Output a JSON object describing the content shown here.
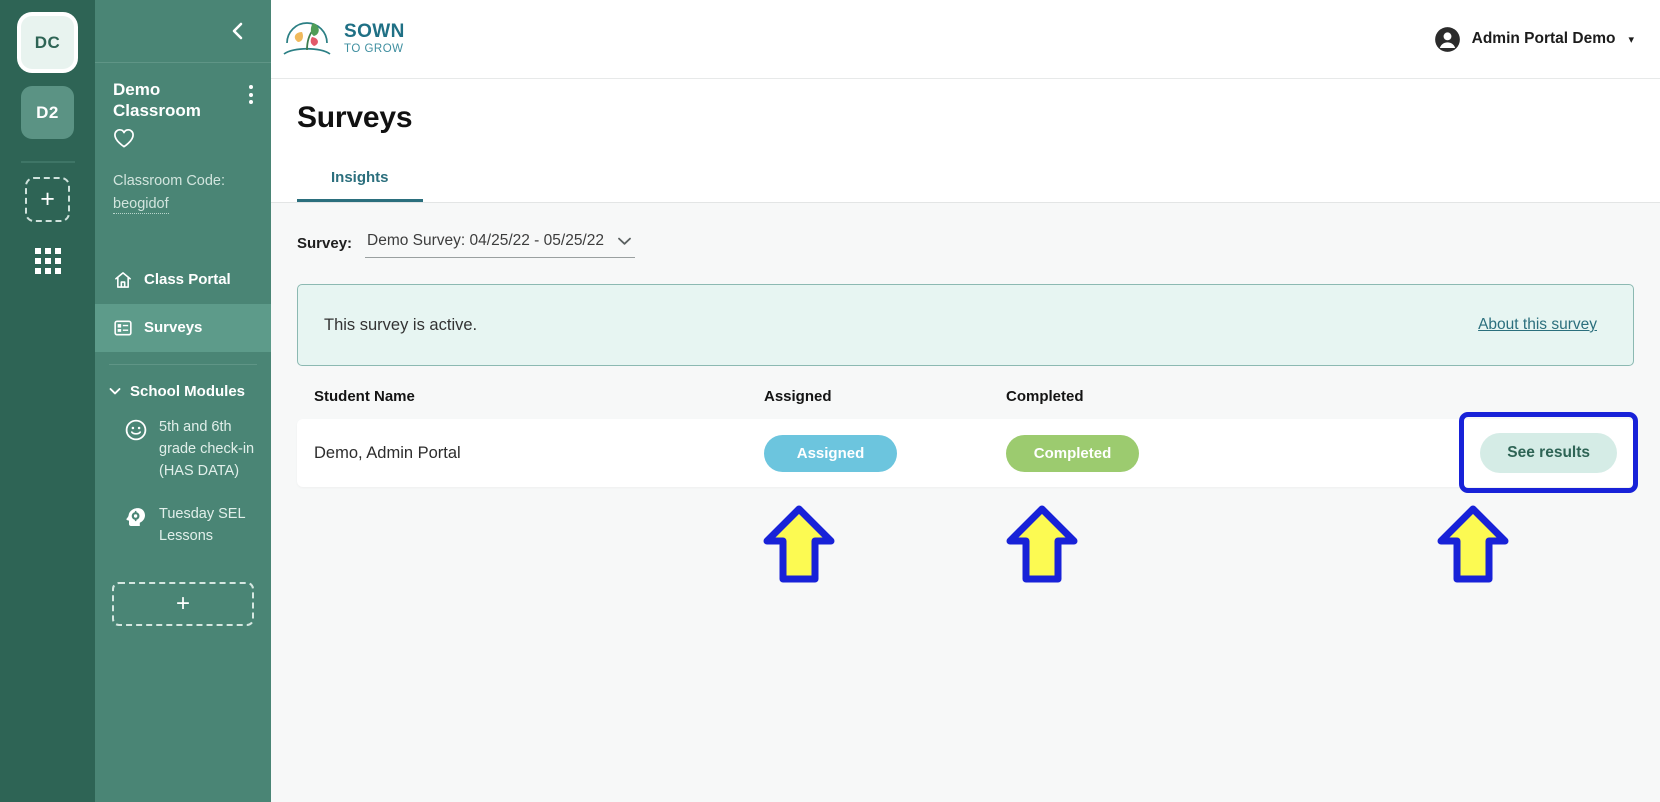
{
  "rail": {
    "avatars": [
      {
        "label": "DC",
        "state": "active"
      },
      {
        "label": "D2",
        "state": "inactive"
      }
    ],
    "add_label": "+",
    "grid_icon": "apps-grid-icon"
  },
  "sidebar": {
    "collapse_icon": "chevron-left-icon",
    "classroom_name": "Demo Classroom",
    "kebab_icon": "kebab-menu-icon",
    "favorite_icon": "heart-icon",
    "classroom_code_label": "Classroom Code:",
    "classroom_code_value": "beogidof",
    "nav": [
      {
        "label": "Class Portal",
        "icon": "home-icon",
        "active": false
      },
      {
        "label": "Surveys",
        "icon": "survey-list-icon",
        "active": true
      }
    ],
    "section_title": "School Modules",
    "section_chevron": "chevron-down-icon",
    "modules": [
      {
        "label": "5th and 6th grade check-in (HAS DATA)",
        "icon": "smiley-face-icon"
      },
      {
        "label": "Tuesday SEL Lessons",
        "icon": "head-gear-icon"
      }
    ],
    "add_module_label": "+"
  },
  "topbar": {
    "logo_icon": "sown-to-grow-leaf-logo",
    "brand_top": "SOWN",
    "brand_bottom": "TO GROW",
    "account_icon": "user-avatar-icon",
    "account_name": "Admin Portal Demo",
    "account_caret": "▾"
  },
  "page": {
    "title": "Surveys",
    "tabs": [
      {
        "label": "Insights",
        "active": true
      }
    ]
  },
  "survey_picker": {
    "label": "Survey:",
    "selected": "Demo Survey: 04/25/22 - 05/25/22",
    "caret_icon": "chevron-down-icon"
  },
  "banner": {
    "message": "This survey is active.",
    "link_label": "About this survey"
  },
  "table": {
    "headers": {
      "name": "Student Name",
      "assigned": "Assigned",
      "completed": "Completed"
    },
    "rows": [
      {
        "name": "Demo, Admin Portal",
        "assigned_badge": "Assigned",
        "completed_badge": "Completed",
        "action_label": "See results"
      }
    ]
  },
  "annotations": {
    "highlight_color": "#1822d8",
    "arrow_fill": "#fcfa52",
    "arrow_stroke": "#1822d8",
    "arrows": [
      {
        "name": "arrow-to-assigned"
      },
      {
        "name": "arrow-to-completed"
      },
      {
        "name": "arrow-to-see-results"
      }
    ]
  },
  "colors": {
    "rail_bg": "#2e6455",
    "sidebar_bg": "#4a8575",
    "accent_teal": "#2b6f7d",
    "assigned_badge": "#6cc5de",
    "completed_badge": "#9ccb6f"
  }
}
